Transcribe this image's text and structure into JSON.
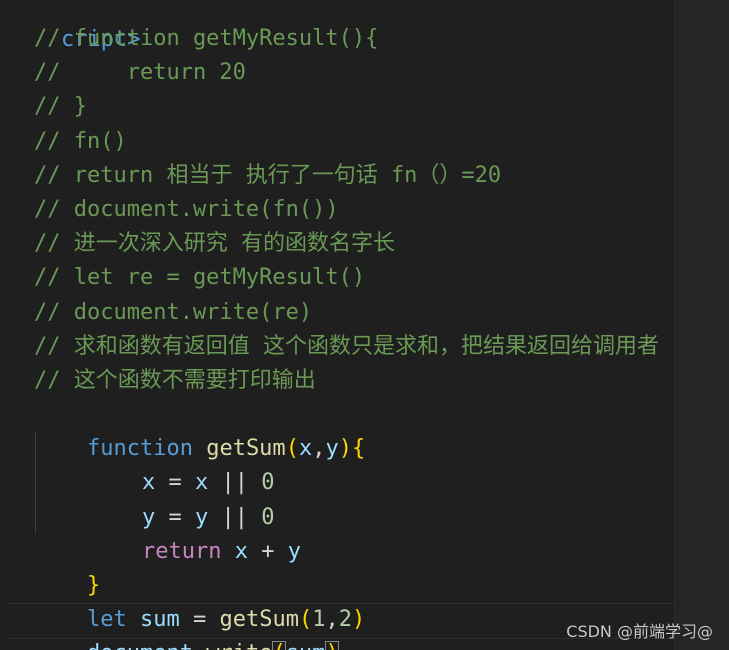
{
  "editor": {
    "script_tag_fragment": "cript>",
    "comments": [
      "// function getMyResult(){",
      "//     return 20",
      "// }",
      "// fn()",
      "// return 相当于 执行了一句话 fn（）=20",
      "// document.write(fn())",
      "// 进一次深入研究 有的函数名字长",
      "// let re = getMyResult()",
      "// document.write(re)",
      "// 求和函数有返回值 这个函数只是求和，把结果返回给调用者",
      "// 这个函数不需要打印输出"
    ],
    "code": {
      "kw_function": "function",
      "fn_name": "getSum",
      "paren_open": "(",
      "param_x": "x",
      "comma": ",",
      "param_y": "y",
      "paren_close": ")",
      "brace_open": "{",
      "line_x_var": "x",
      "eq": " = ",
      "line_x_rhs": "x",
      "or": " || ",
      "zero": "0",
      "line_y_var": "y",
      "line_y_rhs": "y",
      "kw_return": "return",
      "ret_x": "x",
      "plus": " + ",
      "ret_y": "y",
      "brace_close": "}",
      "kw_let": "let",
      "sum_var": "sum",
      "call_fn": "getSum",
      "arg1": "1",
      "arg2": "2",
      "doc": "document",
      "dot": ".",
      "write": "write",
      "sum_arg": "sum"
    }
  },
  "watermark": "CSDN @前端学习@"
}
